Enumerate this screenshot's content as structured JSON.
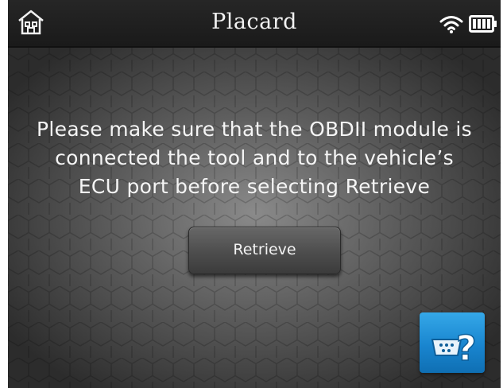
{
  "header": {
    "title": "Placard",
    "icons": [
      "home-icon",
      "wifi-icon",
      "battery-icon"
    ]
  },
  "main": {
    "message_lines": [
      "Please make sure that the OBDII module is",
      "connected the tool and to the vehicle’s",
      "ECU port before selecting Retrieve"
    ],
    "retrieve_label": "Retrieve"
  },
  "help": {
    "icon": "obd-help-icon"
  },
  "colors": {
    "topbar": "#1f1f1f",
    "background_center": "#8a8a8a",
    "background_edge": "#2c2c2c",
    "help_button": "#1985cf",
    "text": "#f5f5f5"
  }
}
